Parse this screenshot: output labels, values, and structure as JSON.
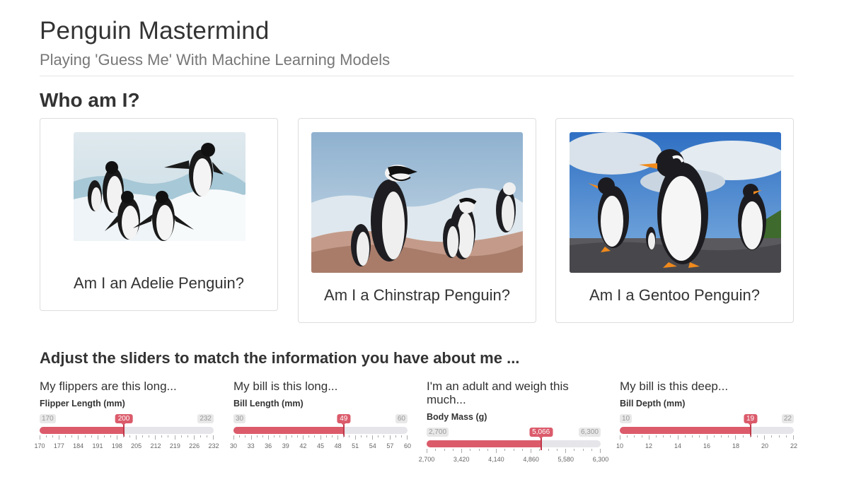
{
  "header": {
    "title": "Penguin Mastermind",
    "subtitle": "Playing 'Guess Me' With Machine Learning Models"
  },
  "who_heading": "Who am I?",
  "cards": [
    {
      "caption": "Am I an Adelie Penguin?",
      "image": "adelie-penguins-on-ice-photo"
    },
    {
      "caption": "Am I a Chinstrap Penguin?",
      "image": "chinstrap-penguins-on-rocks-photo"
    },
    {
      "caption": "Am I a Gentoo Penguin?",
      "image": "gentoo-penguins-on-beach-photo"
    }
  ],
  "sliders_heading": "Adjust the sliders to match the information you have about me ...",
  "sliders": [
    {
      "question": "My flippers are this long...",
      "label": "Flipper Length (mm)",
      "min": 170,
      "max": 232,
      "value": 200,
      "min_text": "170",
      "max_text": "232",
      "value_text": "200",
      "ticks": [
        "170",
        "177",
        "184",
        "191",
        "198",
        "205",
        "212",
        "219",
        "226",
        "232"
      ]
    },
    {
      "question": "My bill is this long...",
      "label": "Bill Length (mm)",
      "min": 30,
      "max": 60,
      "value": 49,
      "min_text": "30",
      "max_text": "60",
      "value_text": "49",
      "ticks": [
        "30",
        "33",
        "36",
        "39",
        "42",
        "45",
        "48",
        "51",
        "54",
        "57",
        "60"
      ]
    },
    {
      "question": "I'm an adult and weigh this much...",
      "label": "Body Mass (g)",
      "min": 2700,
      "max": 6300,
      "value": 5066,
      "min_text": "2,700",
      "max_text": "6,300",
      "value_text": "5,066",
      "ticks": [
        "2,700",
        "3,420",
        "4,140",
        "4,860",
        "5,580",
        "6,300"
      ]
    },
    {
      "question": "My bill is this deep...",
      "label": "Bill Depth (mm)",
      "min": 10,
      "max": 22,
      "value": 19,
      "min_text": "10",
      "max_text": "22",
      "value_text": "19",
      "ticks": [
        "10",
        "12",
        "14",
        "16",
        "18",
        "20",
        "22"
      ]
    }
  ],
  "colors": {
    "accent": "#db5b6b",
    "track": "#e5e5ea"
  }
}
